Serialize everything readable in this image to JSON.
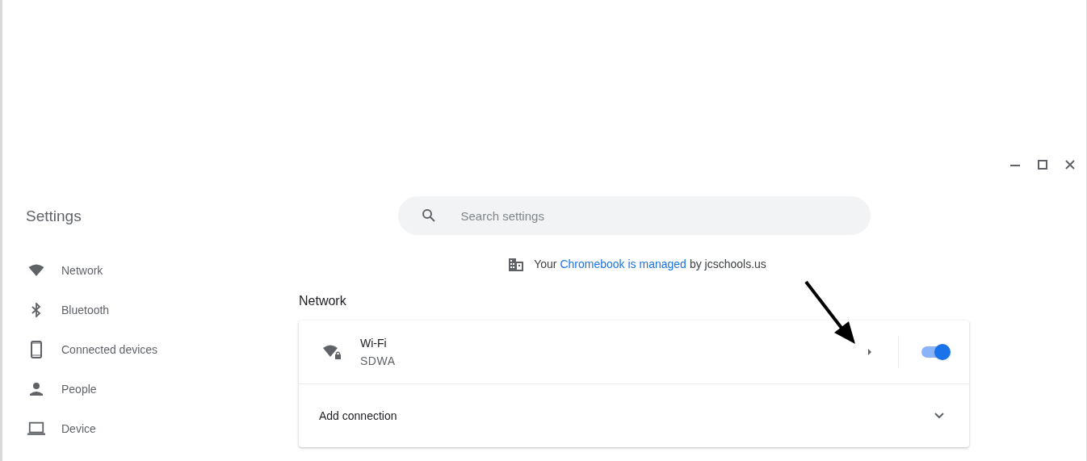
{
  "sidebar": {
    "title": "Settings",
    "items": [
      {
        "label": "Network",
        "kind": "wifi"
      },
      {
        "label": "Bluetooth",
        "kind": "bluetooth"
      },
      {
        "label": "Connected devices",
        "kind": "phone"
      },
      {
        "label": "People",
        "kind": "person"
      },
      {
        "label": "Device",
        "kind": "laptop"
      }
    ]
  },
  "search": {
    "placeholder": "Search settings"
  },
  "managed_notice": {
    "prefix": "Your",
    "link": "Chromebook is managed",
    "suffix": "by jcschools.us"
  },
  "section": {
    "title": "Network",
    "wifi": {
      "title": "Wi-Fi",
      "network": "SDWA",
      "on": true
    },
    "add_connection": {
      "label": "Add connection",
      "expanded": false
    }
  }
}
